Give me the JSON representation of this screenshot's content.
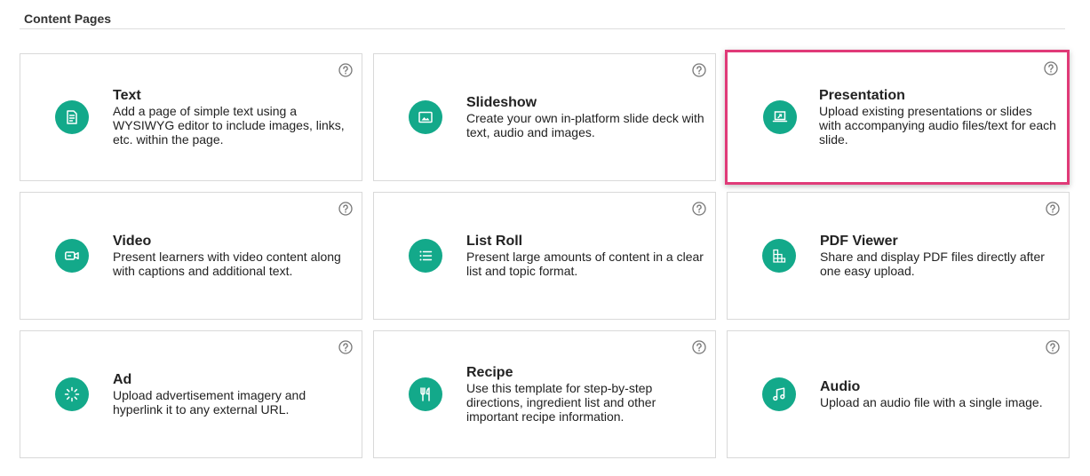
{
  "section": {
    "title": "Content Pages"
  },
  "colors": {
    "accent": "#13a98a",
    "highlight_border": "#e03a78"
  },
  "cards": [
    {
      "title": "Text",
      "description": "Add a page of simple text using a WYSIWYG editor to include images, links, etc. within the page.",
      "icon": "text-page-icon"
    },
    {
      "title": "Slideshow",
      "description": "Create your own in-platform slide deck with text, audio and images.",
      "icon": "slideshow-icon"
    },
    {
      "title": "Presentation",
      "description": "Upload existing presentations or slides with accompanying audio files/text for each slide.",
      "icon": "presentation-icon",
      "highlighted": true
    },
    {
      "title": "Video",
      "description": "Present learners with video content along with captions and additional text.",
      "icon": "video-icon"
    },
    {
      "title": "List Roll",
      "description": "Present large amounts of content in a clear list and topic format.",
      "icon": "list-icon"
    },
    {
      "title": "PDF Viewer",
      "description": "Share and display PDF files directly after one easy upload.",
      "icon": "pdf-viewer-icon"
    },
    {
      "title": "Ad",
      "description": "Upload advertisement imagery and hyperlink it to any external URL.",
      "icon": "ad-icon"
    },
    {
      "title": "Recipe",
      "description": "Use this template for step-by-step directions, ingredient list and other important recipe information.",
      "icon": "recipe-icon"
    },
    {
      "title": "Audio",
      "description": "Upload an audio file with a single image.",
      "icon": "audio-icon"
    }
  ]
}
